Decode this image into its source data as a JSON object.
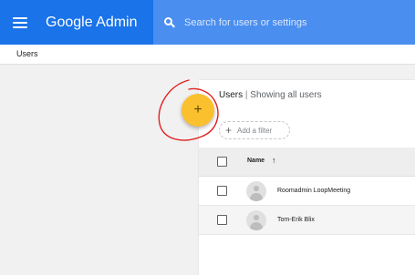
{
  "header": {
    "app_title": "Google Admin",
    "menu_icon": "hamburger-menu-icon",
    "search": {
      "placeholder": "Search for users or settings",
      "icon": "search-icon"
    }
  },
  "breadcrumb": {
    "label": "Users"
  },
  "users_panel": {
    "title": "Users",
    "separator": "|",
    "subtitle": "Showing all users",
    "add_filter": {
      "icon": "plus-icon",
      "label": "Add a filter"
    },
    "table": {
      "columns": [
        {
          "label": "Name",
          "sort": "arrow-up-icon",
          "sort_glyph": "↑"
        }
      ],
      "rows": [
        {
          "name": "Roomadmin LoopMeeting",
          "avatar": "avatar-placeholder-icon"
        },
        {
          "name": "Tom-Erik Blix",
          "avatar": "avatar-placeholder-icon"
        }
      ]
    }
  },
  "fab": {
    "icon": "plus-icon",
    "glyph": "+"
  },
  "colors": {
    "header_bg": "#1a73e8",
    "search_bg": "#4a8ef0",
    "fab_bg": "#fbc02d",
    "annotation_red": "#e02020"
  },
  "annotation": {
    "type": "hand-drawn-circle",
    "color": "#e02020"
  }
}
